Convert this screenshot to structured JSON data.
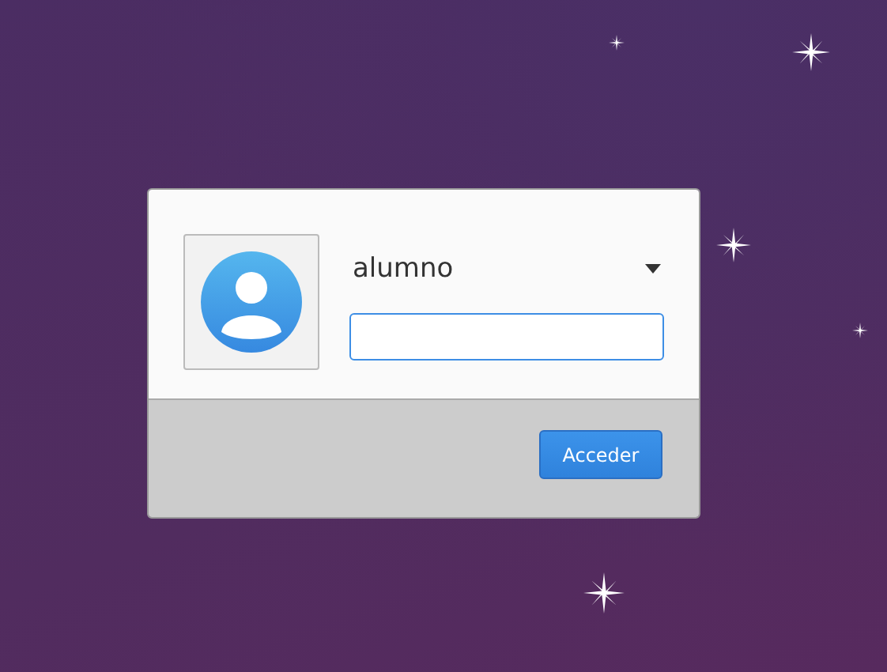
{
  "user": {
    "name": "alumno"
  },
  "password_field": {
    "focused": true
  },
  "buttons": [
    {
      "label": "Acceder"
    }
  ]
}
